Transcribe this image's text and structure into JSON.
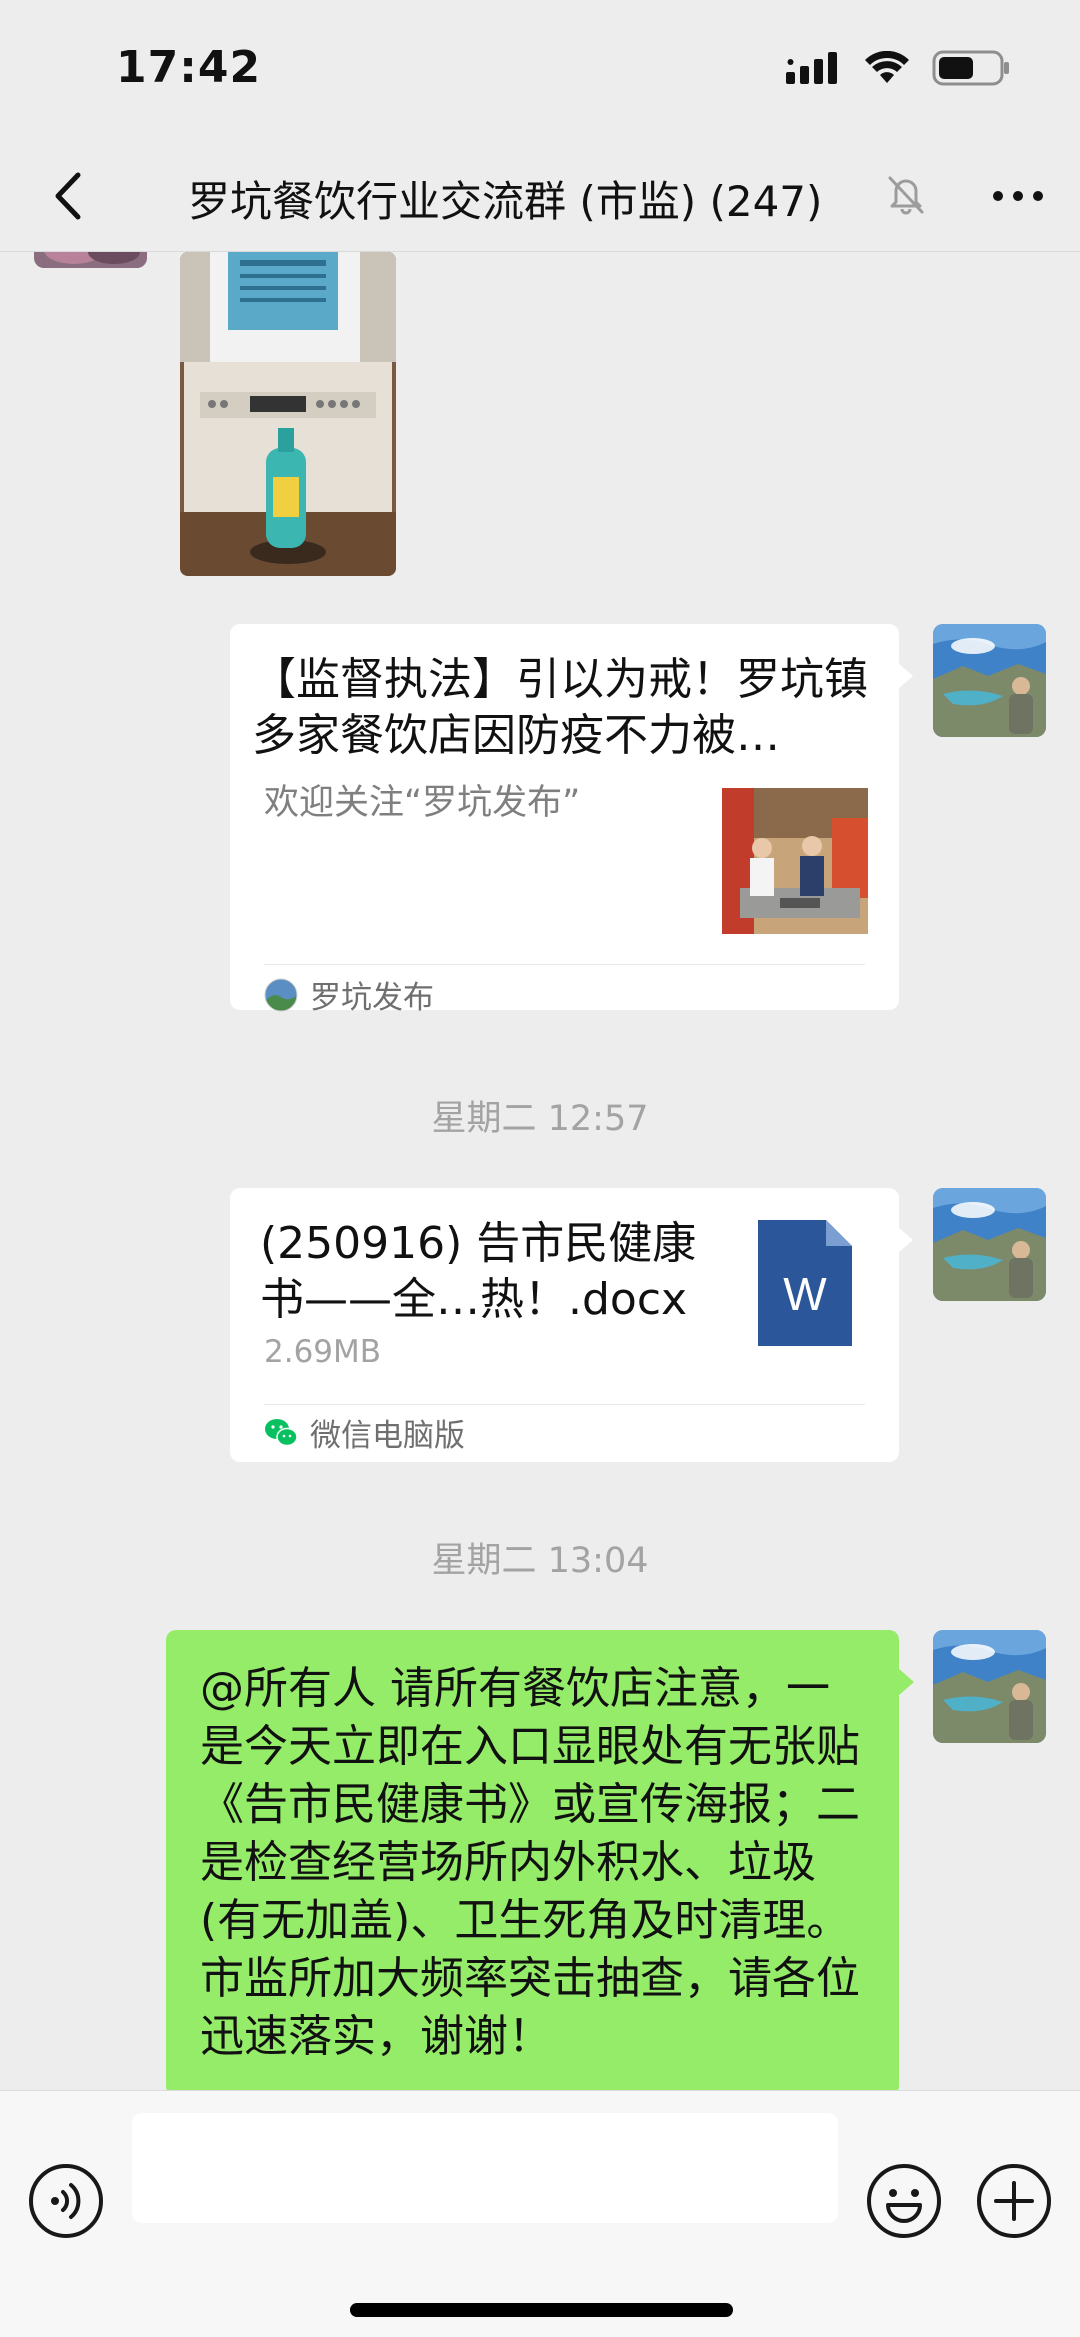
{
  "status_bar": {
    "time": "17:42",
    "icons": [
      "signal-icon",
      "wifi-icon",
      "battery-icon"
    ]
  },
  "header": {
    "title": "罗坑餐饮行业交流群 (市监) (247)",
    "back_icon": "chevron-left-icon",
    "mute_icon": "bell-slash-icon",
    "more_icon": "more-dots-icon"
  },
  "messages": {
    "article": {
      "title": "【监督执法】引以为戒！罗坑镇多家餐饮店因防疫不力被…",
      "description": "欢迎关注“罗坑发布”",
      "source": "罗坑发布"
    },
    "timestamp_1": "星期二 12:57",
    "file": {
      "name": "(250916) 告市民健康书——全…热！.docx",
      "size": "2.69MB",
      "icon_letter": "W",
      "source": "微信电脑版"
    },
    "timestamp_2": "星期二 13:04",
    "text": "@所有人 请所有餐饮店注意，一是今天立即在入口显眼处有无张贴《告市民健康书》或宣传海报；二是检查经营场所内外积水、垃圾 (有无加盖)、卫生死角及时清理。市监所加大频率突击抽查，请各位迅速落实，谢谢！"
  },
  "input_bar": {
    "placeholder": "",
    "voice_icon": "voice-icon",
    "emoji_icon": "emoji-icon",
    "plus_icon": "plus-icon"
  },
  "colors": {
    "background": "#ededed",
    "bubble_green": "#95ec69",
    "word_blue": "#2b579a",
    "wechat_green": "#07c160"
  }
}
